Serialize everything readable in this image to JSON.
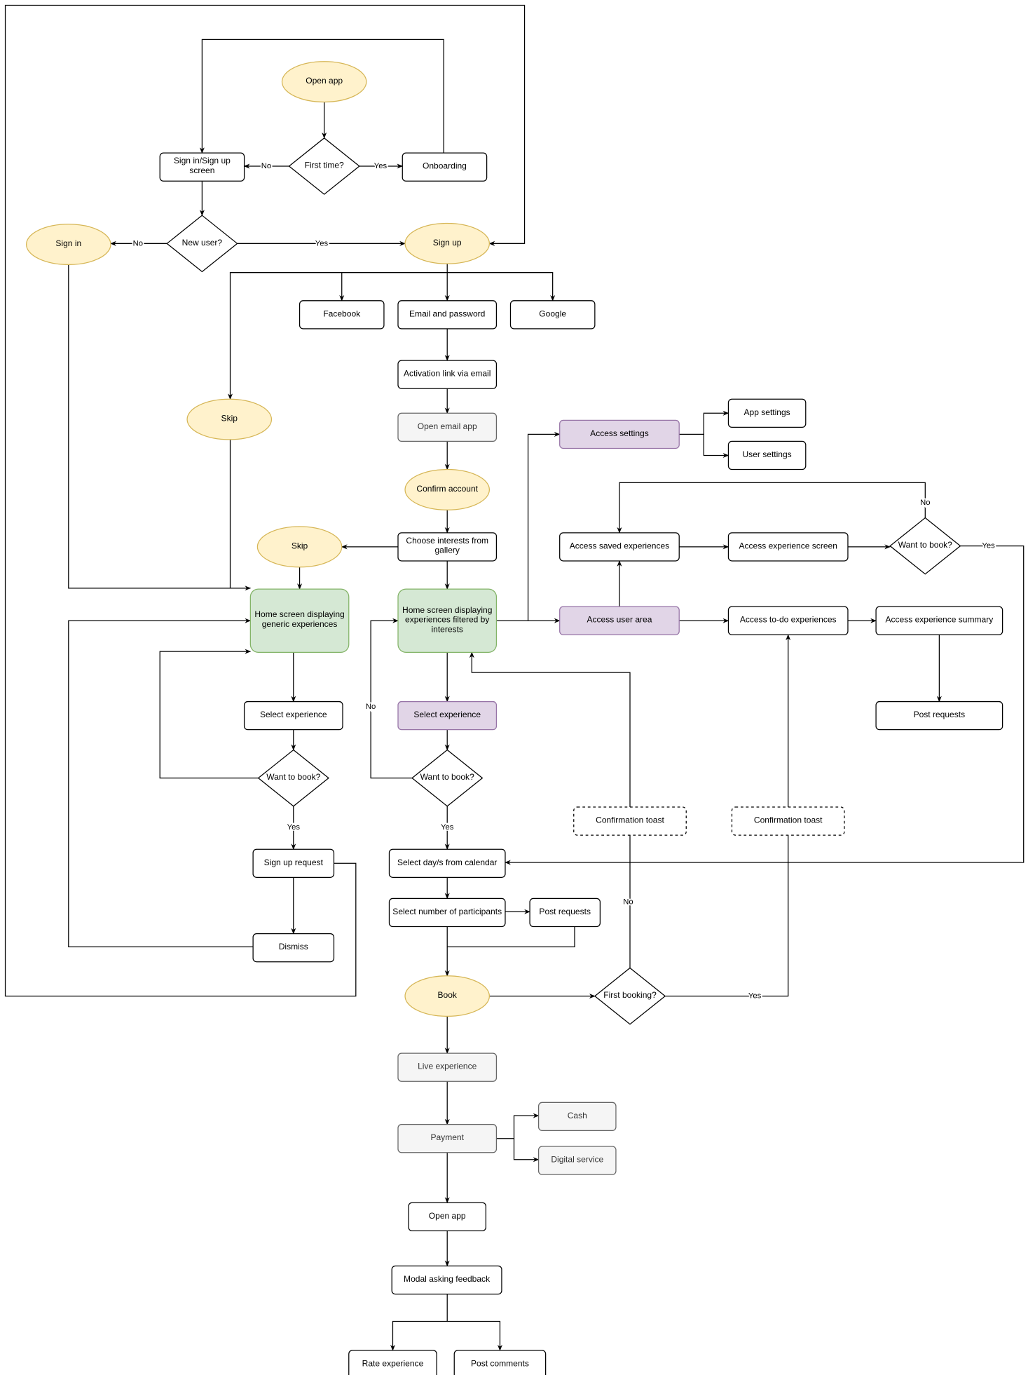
{
  "nodes": {
    "open_app": "Open app",
    "first_time": "First time?",
    "signin_screen": "Sign in/Sign up screen",
    "onboarding": "Onboarding",
    "new_user": "New user?",
    "sign_in": "Sign in",
    "sign_up": "Sign up",
    "facebook": "Facebook",
    "email_password": "Email and password",
    "google": "Google",
    "activation": "Activation link via email",
    "open_email": "Open email app",
    "skip_1": "Skip",
    "confirm_account": "Confirm account",
    "choose_interests": "Choose interests from gallery",
    "skip_2": "Skip",
    "home_generic": "Home screen displaying generic experiences",
    "home_filtered": "Home screen displaying experiences filtered by interests",
    "access_settings": "Access settings",
    "app_settings": "App settings",
    "user_settings": "User settings",
    "saved_experiences": "Access saved experiences",
    "experience_screen": "Access experience screen",
    "want_book_3": "Want to book?",
    "user_area": "Access user area",
    "todo_experiences": "Access to-do experiences",
    "experience_summary": "Access experience summary",
    "post_requests_2": "Post requests",
    "select_experience_1": "Select experience",
    "want_book_1": "Want to book?",
    "select_experience_2": "Select experience",
    "want_book_2": "Want to book?",
    "toast_1": "Confirmation toast",
    "toast_2": "Confirmation toast",
    "signup_request": "Sign up request",
    "dismiss": "Dismiss",
    "select_days": "Select day/s from calendar",
    "participants": "Select number of participants",
    "post_requests_1": "Post requests",
    "book": "Book",
    "first_booking": "First booking?",
    "live_experience": "Live experience",
    "payment": "Payment",
    "cash": "Cash",
    "digital_service": "Digital service",
    "open_app_2": "Open app",
    "modal_feedback": "Modal asking feedback",
    "rate_experience": "Rate experience",
    "post_comments": "Post comments"
  },
  "edge_labels": {
    "first_time_no": "No",
    "first_time_yes": "Yes",
    "new_user_no": "No",
    "new_user_yes": "Yes",
    "want_book_1_yes": "Yes",
    "want_book_2_no": "No",
    "want_book_2_yes": "Yes",
    "want_book_3_no": "No",
    "want_book_3_yes": "Yes",
    "first_booking_no": "No",
    "first_booking_yes": "Yes"
  },
  "colors": {
    "terminal_fill": "#fff2cc",
    "terminal_stroke": "#d6b656",
    "home_fill": "#d5e8d4",
    "home_stroke": "#82b366",
    "highlight_fill": "#e1d5e7",
    "highlight_stroke": "#9673a6",
    "external_fill": "#f5f5f5",
    "external_stroke": "#666666",
    "default_fill": "#ffffff",
    "default_stroke": "#000000"
  }
}
